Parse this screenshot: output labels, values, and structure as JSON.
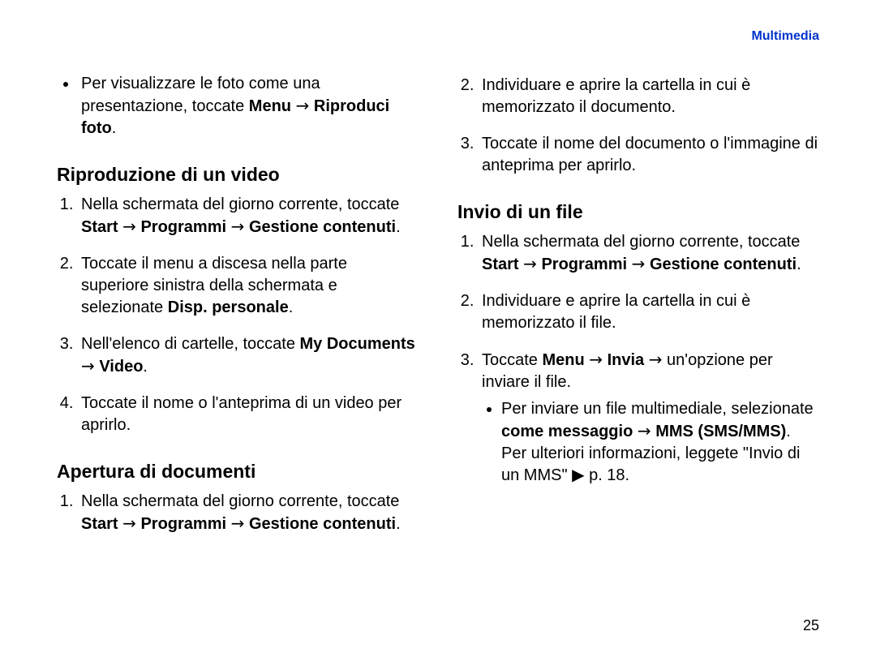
{
  "header": {
    "section_label": "Multimedia"
  },
  "page_number": "25",
  "arrow": "→",
  "tri": "▶",
  "left": {
    "intro_bullet": {
      "pre": "Per visualizzare le foto come una presentazione, toccate ",
      "menu": "Menu",
      "riproduci": "Riproduci foto",
      "period": "."
    },
    "h_video": "Riproduzione di un video",
    "video_steps": {
      "s1_pre": "Nella schermata del giorno corrente, toccate ",
      "s1_b1": "Start",
      "s1_b2": "Programmi",
      "s1_b3": "Gestione contenuti",
      "s2_pre": "Toccate il menu a discesa nella parte superiore sinistra della schermata e selezionate ",
      "s2_b": "Disp. personale",
      "s3_pre": "Nell'elenco di cartelle, toccate ",
      "s3_b1": "My Documents",
      "s3_b2": "Video",
      "s4": "Toccate il nome o l'anteprima di un video per aprirlo."
    },
    "h_doc": "Apertura di documenti",
    "doc_steps": {
      "s1_pre": "Nella schermata del giorno corrente, toccate ",
      "s1_b1": "Start",
      "s1_b2": "Programmi",
      "s1_b3": "Gestione contenuti"
    }
  },
  "right": {
    "doc_cont": {
      "s2": "Individuare e aprire la cartella in cui è memorizzato il documento.",
      "s3": "Toccate il nome del documento o l'immagine di anteprima per aprirlo."
    },
    "h_send": "Invio di un file",
    "send_steps": {
      "s1_pre": "Nella schermata del giorno corrente, toccate ",
      "s1_b1": "Start",
      "s1_b2": "Programmi",
      "s1_b3": "Gestione contenuti",
      "s2": "Individuare e aprire la cartella in cui è memorizzato il file.",
      "s3_pre": "Toccate ",
      "s3_b1": "Menu",
      "s3_b2": "Invia",
      "s3_post": " un'opzione per inviare il file.",
      "sub_pre": "Per inviare un file multimediale, selezionate ",
      "sub_b1": "come messaggio",
      "sub_b2": "MMS (SMS/MMS)",
      "sub_mid": ". Per ulteriori informazioni, leggete \"Invio di un MMS\" ",
      "sub_page": " p. 18."
    }
  }
}
